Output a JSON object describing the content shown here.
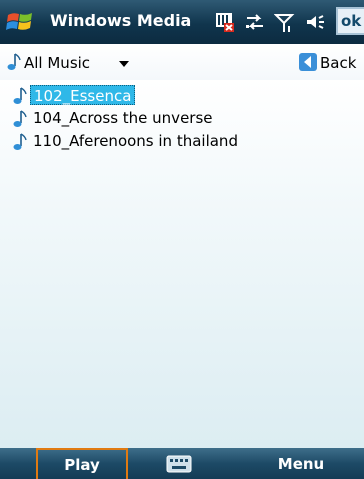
{
  "title_bar": {
    "title": "Windows Media",
    "ok_label": "ok",
    "status_icons": [
      "network-status-icon",
      "data-connection-icon",
      "signal-strength-icon",
      "volume-icon"
    ]
  },
  "nav": {
    "library_label": "All Music",
    "back_label": "Back"
  },
  "tracks": [
    {
      "label": "102_Essenca",
      "selected": true
    },
    {
      "label": "104_Across the unverse",
      "selected": false
    },
    {
      "label": "110_Aferenoons in thailand",
      "selected": false
    }
  ],
  "softkeys": {
    "left_label": "Play",
    "right_label": "Menu"
  },
  "colors": {
    "title_bar": "#10354d",
    "selection": "#2fb8e8",
    "softkey_focus": "#e07a12"
  }
}
